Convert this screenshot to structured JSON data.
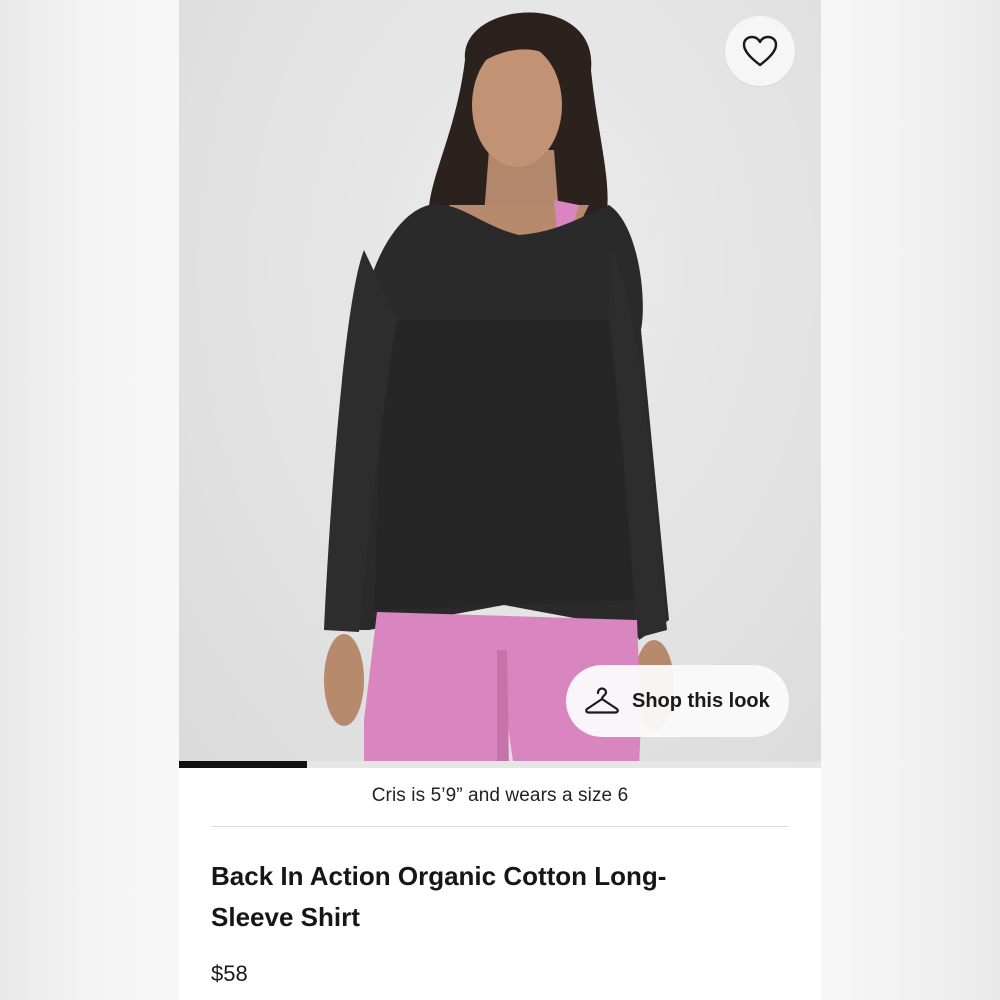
{
  "product": {
    "title": "Back In Action Organic Cotton Long-Sleeve Shirt",
    "price": "$58",
    "model_caption": "Cris is 5’9” and wears a size 6"
  },
  "hero": {
    "favorite_icon": "heart-outline-icon",
    "shop_look_label": "Shop this look",
    "shop_look_icon": "hanger-icon",
    "carousel_progress": 0.2,
    "colors": {
      "shirt": "#2a2a2a",
      "shorts": "#d985bf",
      "background": "#e3e3e3"
    }
  }
}
